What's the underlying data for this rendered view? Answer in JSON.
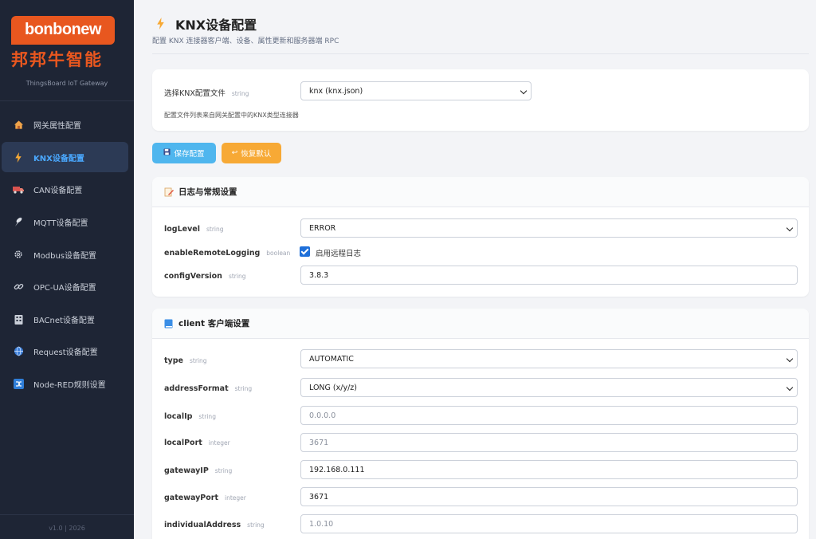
{
  "brand": {
    "logo_en": "bonbonew",
    "logo_cn": "邦邦牛智能",
    "subtitle": "ThingsBoard IoT Gateway",
    "accent": "#e8571f"
  },
  "sidebar": {
    "items": [
      {
        "label": "网关属性配置",
        "icon": "home-icon",
        "active": false
      },
      {
        "label": "KNX设备配置",
        "icon": "lightning-icon",
        "active": true
      },
      {
        "label": "CAN设备配置",
        "icon": "truck-icon",
        "active": false
      },
      {
        "label": "MQTT设备配置",
        "icon": "antenna-icon",
        "active": false
      },
      {
        "label": "Modbus设备配置",
        "icon": "gear-icon",
        "active": false
      },
      {
        "label": "OPC-UA设备配置",
        "icon": "link-icon",
        "active": false
      },
      {
        "label": "BACnet设备配置",
        "icon": "building-icon",
        "active": false
      },
      {
        "label": "Request设备配置",
        "icon": "globe-icon",
        "active": false
      },
      {
        "label": "Node-RED规则设置",
        "icon": "shuffle-icon",
        "active": false
      }
    ],
    "footer": "v1.0 | 2026"
  },
  "header": {
    "title": "KNX设备配置",
    "subtitle": "配置 KNX 连接器客户端、设备、属性更新和服务器端 RPC"
  },
  "config_file": {
    "label": "选择KNX配置文件",
    "type": "string",
    "value": "knx (knx.json)",
    "help": "配置文件列表来自网关配置中的KNX类型连接器"
  },
  "buttons": {
    "save": "保存配置",
    "reset": "恢复默认"
  },
  "log_section": {
    "title": "日志与常规设置",
    "fields": [
      {
        "label": "logLevel",
        "type": "string",
        "value": "ERROR"
      },
      {
        "label": "enableRemoteLogging",
        "type": "boolean",
        "check_label": "启用远程日志",
        "checked": true
      },
      {
        "label": "configVersion",
        "type": "string",
        "value": "3.8.3"
      }
    ]
  },
  "client_section": {
    "title": "client 客户端设置",
    "fields": [
      {
        "label": "type",
        "type": "string",
        "value": "AUTOMATIC"
      },
      {
        "label": "addressFormat",
        "type": "string",
        "value": "LONG (x/y/z)"
      },
      {
        "label": "localIp",
        "type": "string",
        "placeholder": "0.0.0.0"
      },
      {
        "label": "localPort",
        "type": "integer",
        "placeholder": "3671"
      },
      {
        "label": "gatewayIP",
        "type": "string",
        "value": "192.168.0.111"
      },
      {
        "label": "gatewayPort",
        "type": "integer",
        "value": "3671"
      },
      {
        "label": "individualAddress",
        "type": "string",
        "placeholder": "1.0.10"
      }
    ]
  },
  "colors": {
    "sidebar_bg": "#1e2535",
    "active_text": "#4aa8ff",
    "save_button": "#4fb6ee",
    "reset_button": "#f7a935",
    "checkbox": "#1e6fd9"
  }
}
